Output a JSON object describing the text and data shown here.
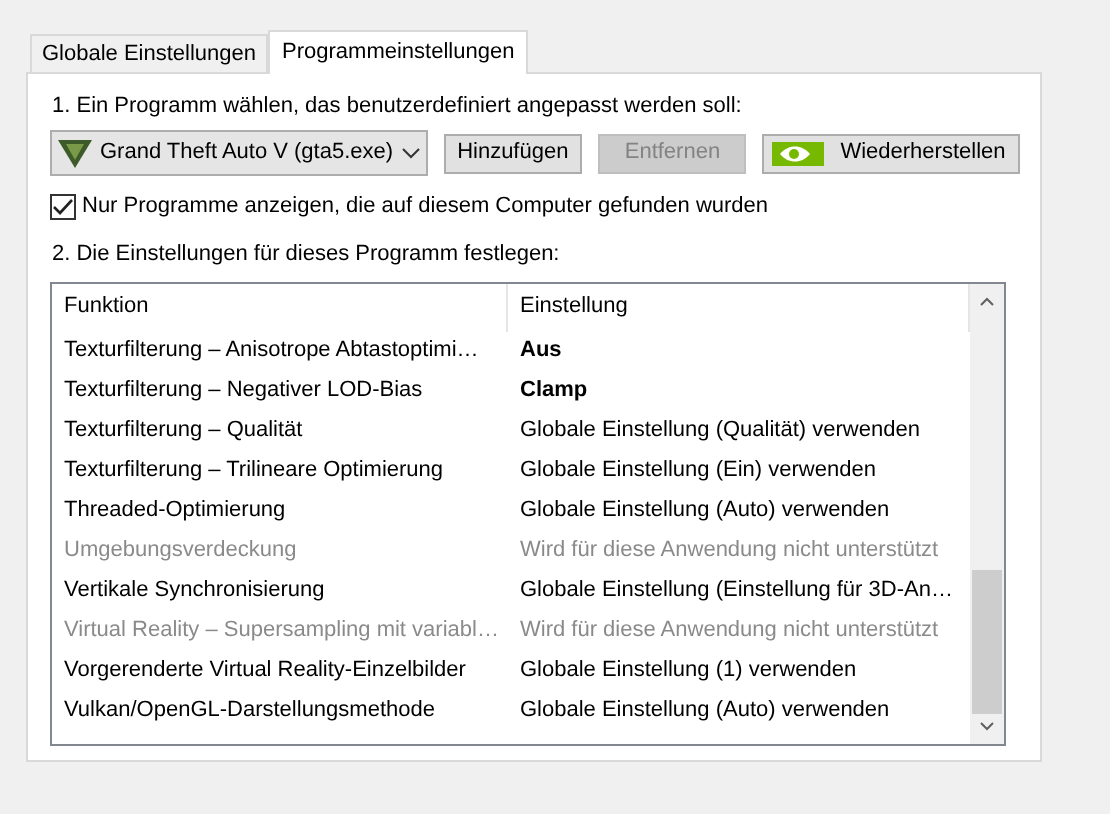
{
  "tabs": [
    {
      "label": "Globale Einstellungen",
      "selected": false
    },
    {
      "label": "Programmeinstellungen",
      "selected": true
    }
  ],
  "step_1": {
    "label": "1. Ein Programm wählen, das benutzerdefiniert angepasst werden soll:",
    "program": "Grand Theft Auto V (gta5.exe)",
    "buttons": [
      {
        "label": "Hinzufügen",
        "disabled": false,
        "kind": "plain"
      },
      {
        "label": "Entfernen",
        "disabled": true,
        "kind": "plain"
      },
      {
        "label": "Wiederherstellen",
        "disabled": false,
        "kind": "logo"
      }
    ]
  },
  "filter_checkbox": {
    "label": "Nur Programme anzeigen, die auf diesem Computer gefunden wurden",
    "checked": true
  },
  "step_2": {
    "label": "2. Die Einstellungen für dieses Programm festlegen:"
  },
  "table": {
    "columns": [
      "Funktion",
      "Einstellung"
    ],
    "rows": [
      {
        "feature": "Texturfilterung – Anisotrope Abtastoptimi…",
        "setting": "Aus",
        "modified": true,
        "disabled": false
      },
      {
        "feature": "Texturfilterung – Negativer LOD-Bias",
        "setting": "Clamp",
        "modified": true,
        "disabled": false
      },
      {
        "feature": "Texturfilterung – Qualität",
        "setting": "Globale Einstellung (Qualität) verwenden",
        "modified": false,
        "disabled": false
      },
      {
        "feature": "Texturfilterung – Trilineare Optimierung",
        "setting": "Globale Einstellung (Ein) verwenden",
        "modified": false,
        "disabled": false
      },
      {
        "feature": "Threaded-Optimierung",
        "setting": "Globale Einstellung (Auto) verwenden",
        "modified": false,
        "disabled": false
      },
      {
        "feature": "Umgebungsverdeckung",
        "setting": "Wird für diese Anwendung nicht unterstützt",
        "modified": false,
        "disabled": true
      },
      {
        "feature": "Vertikale Synchronisierung",
        "setting": "Globale Einstellung (Einstellung für 3D-An…",
        "modified": false,
        "disabled": false
      },
      {
        "feature": "Virtual Reality – Supersampling mit variabl…",
        "setting": "Wird für diese Anwendung nicht unterstützt",
        "modified": false,
        "disabled": true
      },
      {
        "feature": "Vorgerenderte Virtual Reality-Einzelbilder",
        "setting": "Globale Einstellung (1) verwenden",
        "modified": false,
        "disabled": false
      },
      {
        "feature": "Vulkan/OpenGL-Darstellungsmethode",
        "setting": "Globale Einstellung (Auto) verwenden",
        "modified": false,
        "disabled": false
      }
    ]
  }
}
